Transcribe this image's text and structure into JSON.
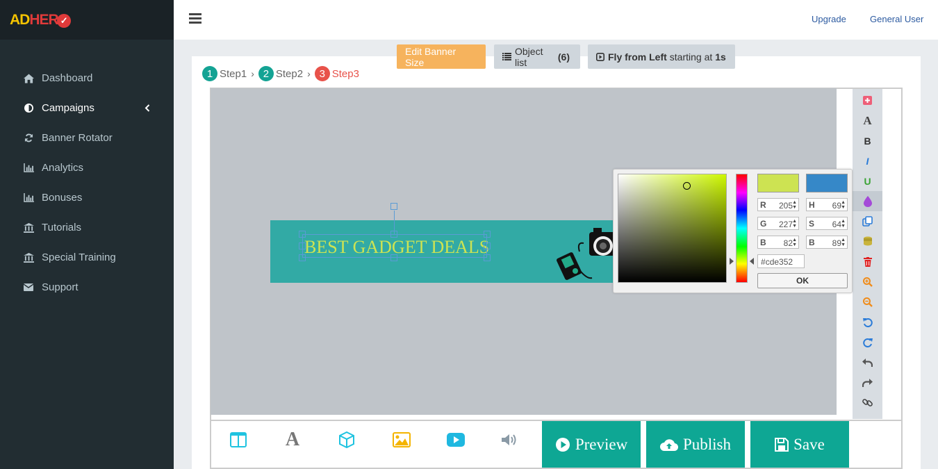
{
  "app": {
    "logo_ad": "AD",
    "logo_hero": "HER",
    "logo_mark": "✓"
  },
  "sidebar": {
    "items": [
      {
        "label": "Dashboard",
        "icon": "home-icon"
      },
      {
        "label": "Campaigns",
        "icon": "adjust-icon",
        "active": true
      },
      {
        "label": "Banner Rotator",
        "icon": "refresh-icon"
      },
      {
        "label": "Analytics",
        "icon": "bar-chart-icon"
      },
      {
        "label": "Bonuses",
        "icon": "bar-chart-icon"
      },
      {
        "label": "Tutorials",
        "icon": "bank-icon"
      },
      {
        "label": "Special Training",
        "icon": "bank-icon"
      },
      {
        "label": "Support",
        "icon": "envelope-icon"
      }
    ]
  },
  "header": {
    "upgrade": "Upgrade",
    "user": "General User"
  },
  "top_buttons": {
    "edit_size": "Edit Banner Size",
    "object_list_label": "Object list",
    "object_list_count": "(6)",
    "anim_effect": "Fly from Left",
    "anim_mid": "starting at",
    "anim_time": "1s"
  },
  "steps": [
    {
      "num": "1",
      "label": "Step1",
      "color": "#14a394"
    },
    {
      "num": "2",
      "label": "Step2",
      "color": "#14a394"
    },
    {
      "num": "3",
      "label": "Step3",
      "color": "#e8524a"
    }
  ],
  "banner": {
    "text": "BEST GADGET DEALS",
    "bg": "#32aaa5",
    "text_color": "#cde352"
  },
  "color_picker": {
    "current_color": "#cde352",
    "original_color": "#3688c8",
    "r": "205",
    "g": "227",
    "b": "82",
    "h": "69",
    "s": "64",
    "bri": "89",
    "r_label": "R",
    "g_label": "G",
    "b_label": "B",
    "h_label": "H",
    "s_label": "S",
    "bri_label": "B",
    "hex": "cde352",
    "ok": "OK"
  },
  "actions": {
    "preview": "Preview",
    "publish": "Publish",
    "save": "Save"
  }
}
